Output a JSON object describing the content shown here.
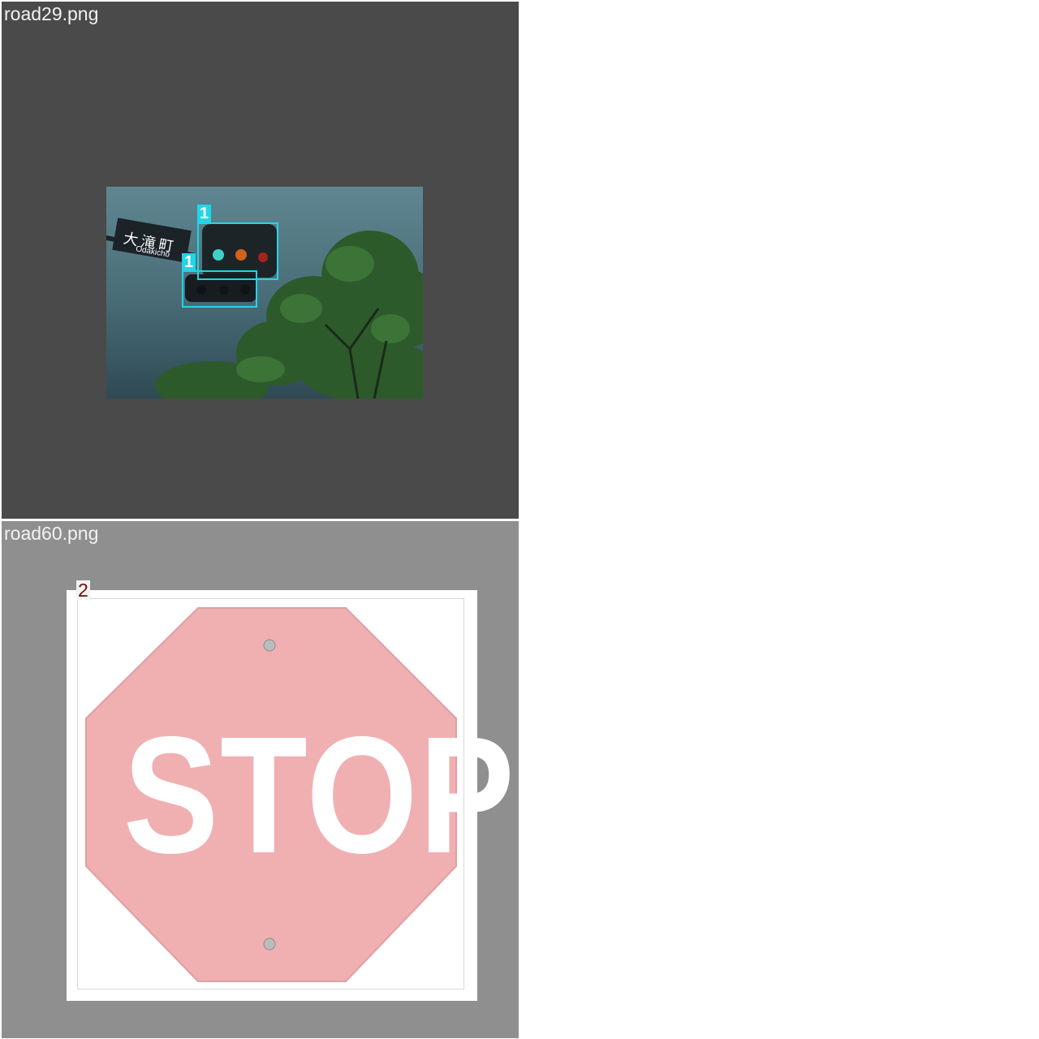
{
  "tiles": [
    {
      "filename": "road29.png",
      "detections": [
        {
          "label": "1"
        },
        {
          "label": "1"
        }
      ],
      "sign": {
        "kanji": "大滝町",
        "romaji": "Odakicho"
      }
    },
    {
      "filename": "road60.png",
      "detections": [
        {
          "label": "2"
        }
      ],
      "sign_text": "STOP"
    }
  ],
  "colors": {
    "tile1_bg": "#4a4a4a",
    "tile2_bg": "#8f8f8f",
    "bbox_class1": "#1fd6e6",
    "bbox_class2_label": "#6b0d0d",
    "stop_sign_fill": "#f0b0b2"
  }
}
